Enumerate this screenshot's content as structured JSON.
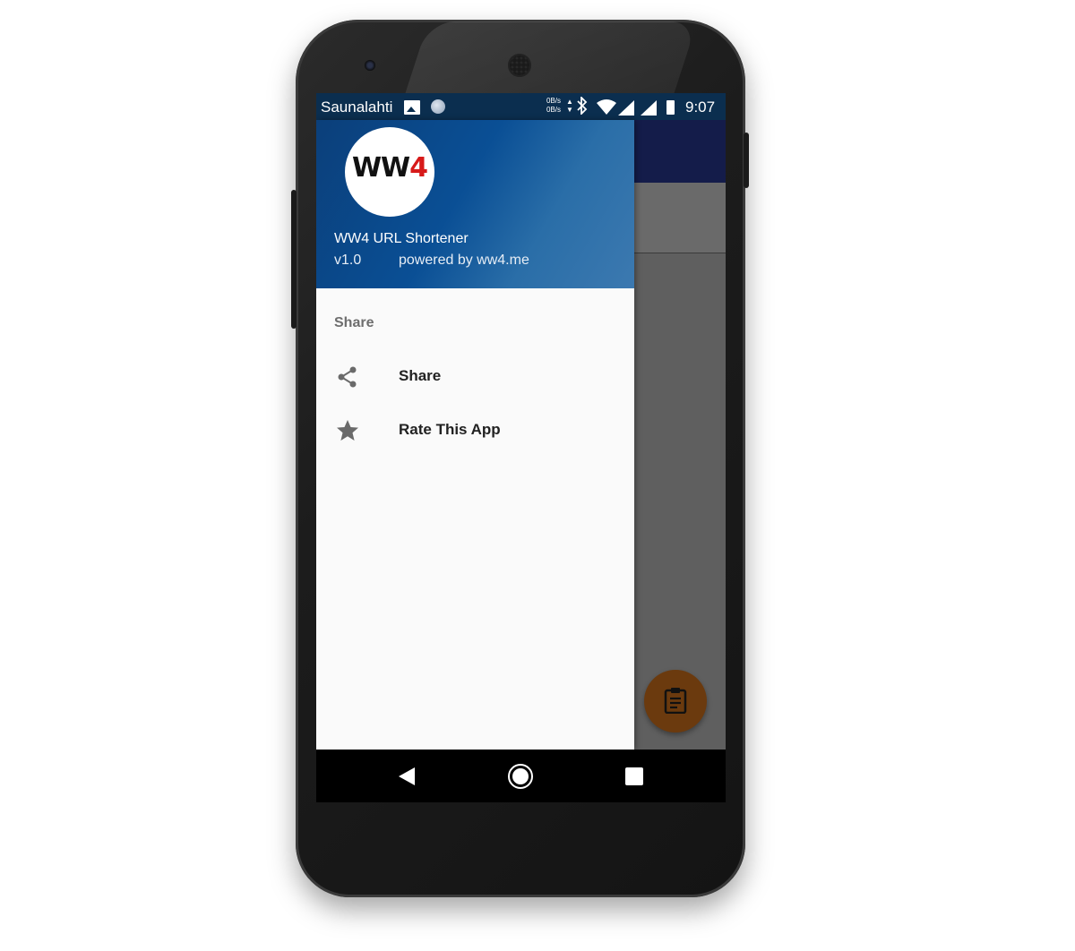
{
  "status_bar": {
    "carrier": "Saunalahti",
    "speed_up": "0B/s",
    "speed_down": "0B/s",
    "time": "9:07",
    "icons": [
      "image-icon",
      "circle-notification-icon",
      "data-arrows-icon",
      "bluetooth-icon",
      "wifi-icon",
      "signal-icon",
      "signal-icon",
      "battery-icon"
    ]
  },
  "drawer": {
    "logo": {
      "text_main": "WW",
      "text_accent": "4"
    },
    "app_name": "WW4 URL Shortener",
    "version": "v1.0",
    "powered_by": "powered by ww4.me",
    "section_title": "Share",
    "items": [
      {
        "label": "Share",
        "icon": "share-icon"
      },
      {
        "label": "Rate This App",
        "icon": "star-icon"
      }
    ]
  },
  "fab": {
    "icon": "clipboard-icon"
  },
  "nav_bar": {
    "icons": [
      "back-icon",
      "home-icon",
      "recents-icon"
    ]
  },
  "colors": {
    "drawer_header": "#0a4f95",
    "status_bar": "#0b2e4f",
    "fab": "#6b3a0e",
    "toolbar": "#141c4a"
  }
}
